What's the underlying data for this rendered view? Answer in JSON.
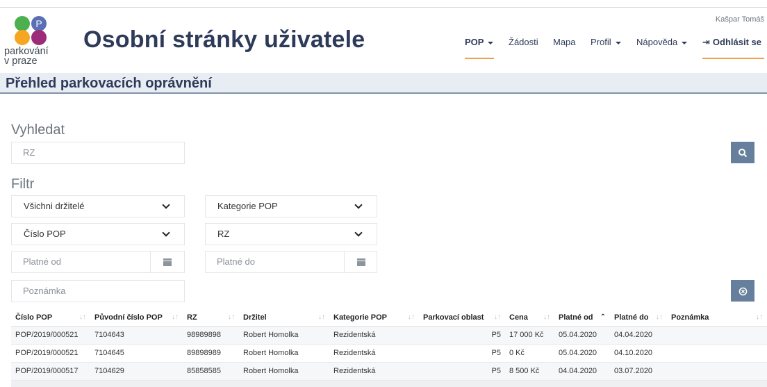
{
  "header": {
    "logo_text_line1": "parkování",
    "logo_text_line2": "v praze",
    "logo_letter": "P",
    "title": "Osobní stránky uživatele",
    "user": "Kašpar Tomáš"
  },
  "nav": {
    "pop": "POP",
    "zadosti": "Žádosti",
    "mapa": "Mapa",
    "profil": "Profil",
    "napoveda": "Nápověda",
    "logout": "Odhlásit se"
  },
  "section": {
    "title": "Přehled parkovacích oprávnění"
  },
  "search": {
    "label": "Vyhledat",
    "placeholder": "RZ"
  },
  "filter": {
    "label": "Filtr",
    "holders": "Všichni držitelé",
    "category": "Kategorie POP",
    "pop_number": "Číslo POP",
    "rz": "RZ",
    "valid_from_placeholder": "Platné od",
    "valid_to_placeholder": "Platné do",
    "note_placeholder": "Poznámka"
  },
  "icons": {
    "search": "search-icon",
    "calendar": "calendar-icon",
    "reset": "reset-icon",
    "logout": "logout-icon"
  },
  "colors": {
    "accent": "#667f9c",
    "title": "#2e3a59",
    "nav_underline": "#f0a050"
  },
  "table": {
    "columns": [
      "Číslo POP",
      "Původní číslo POP",
      "RZ",
      "Držitel",
      "Kategorie POP",
      "Parkovací oblast",
      "Cena",
      "Platné od",
      "Platné do",
      "Poznámka"
    ],
    "rows": [
      [
        "POP/2019/000521",
        "7104643",
        "98989898",
        "Robert Homolka",
        "Rezidentská",
        "P5",
        "17 000 Kč",
        "05.04.2020",
        "04.04.2020",
        ""
      ],
      [
        "POP/2019/000521",
        "7104645",
        "89898989",
        "Robert Homolka",
        "Rezidentská",
        "P5",
        "0 Kč",
        "05.04.2020",
        "04.10.2020",
        ""
      ],
      [
        "POP/2019/000517",
        "7104629",
        "85858585",
        "Robert Homolka",
        "Rezidentská",
        "P5",
        "8 500 Kč",
        "04.04.2020",
        "03.07.2020",
        ""
      ]
    ]
  }
}
